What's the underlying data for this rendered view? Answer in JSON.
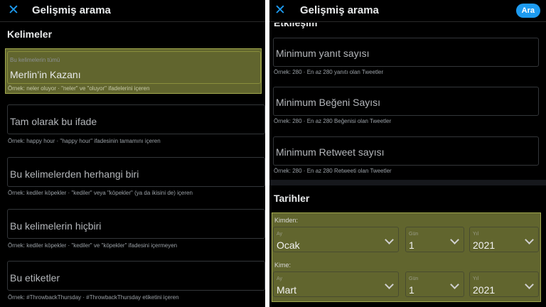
{
  "left": {
    "title": "Gelişmiş arama",
    "section_words": "Kelimeler",
    "fields": [
      {
        "small_label": "Bu kelimelerin tümü",
        "value": "Merlin’in Kazanı",
        "hint": "Örnek: neler oluyor · \"neler\" ve \"oluyor\" ifadelerini içeren"
      },
      {
        "placeholder": "Tam olarak bu ifade",
        "hint": "Örnek: happy hour · \"happy hour\" ifadesinin tamamını içeren"
      },
      {
        "placeholder": "Bu kelimelerden herhangi biri",
        "hint": "Örnek: kediler köpekler · \"kediler\" veya \"köpekler\" (ya da ikisini de) içeren"
      },
      {
        "placeholder": "Bu kelimelerin hiçbiri",
        "hint": "Örnek: kediler köpekler · \"kediler\" ve \"köpekler\" ifadesini içermeyen"
      },
      {
        "placeholder": "Bu etiketler",
        "hint": "Örnek: #ThrowbackThursday · #ThrowbackThursday etiketini içeren"
      }
    ]
  },
  "right": {
    "title": "Gelişmiş arama",
    "search_button": "Ara",
    "section_engagement_partial": "Etkileşim",
    "fields": [
      {
        "placeholder": "Minimum yanıt sayısı",
        "hint": "Örnek: 280 · En az 280 yanıtı olan Tweetler"
      },
      {
        "placeholder": "Minimum Beğeni Sayısı",
        "hint": "Örnek: 280 · En az 280 Beğenisi olan Tweetler"
      },
      {
        "placeholder": "Minimum Retweet sayısı",
        "hint": "Örnek: 280 · En az 280 Retweeti olan Tweetler"
      }
    ],
    "section_dates": "Tarihler",
    "from": {
      "label": "Kimden:",
      "month": {
        "small": "Ay",
        "value": "Ocak"
      },
      "day": {
        "small": "Gün",
        "value": "1"
      },
      "year": {
        "small": "Yıl",
        "value": "2021"
      }
    },
    "to": {
      "label": "Kime:",
      "month": {
        "small": "Ay",
        "value": "Mart"
      },
      "day": {
        "small": "Gün",
        "value": "1"
      },
      "year": {
        "small": "Yıl",
        "value": "2021"
      }
    }
  },
  "colors": {
    "accent": "#1d9bf0",
    "highlight": "#e6f06e",
    "background": "#000000"
  }
}
